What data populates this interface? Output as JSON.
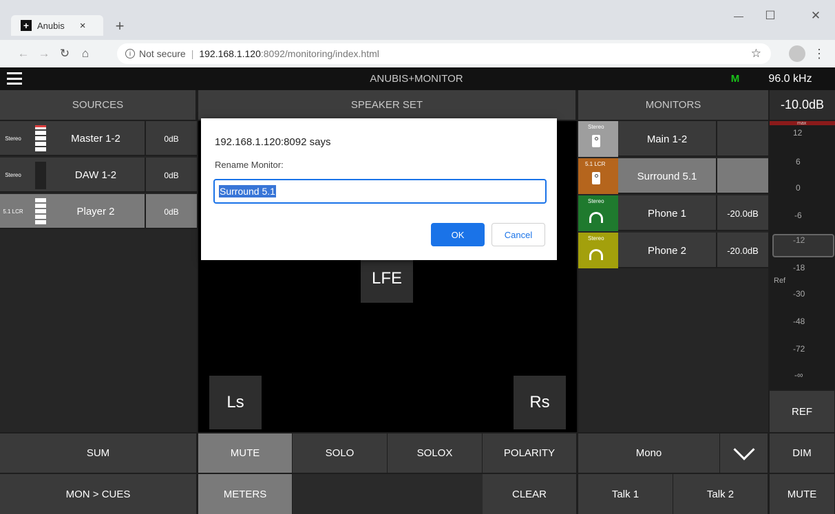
{
  "browser": {
    "tab_title": "Anubis",
    "tab_close": "×",
    "new_tab": "+",
    "security_label": "Not secure",
    "url_host": "192.168.1.120",
    "url_rest": ":8092/monitoring/index.html",
    "window_minimize": "—",
    "window_maximize": "☐",
    "window_close": "✕"
  },
  "app": {
    "title": "ANUBIS+MONITOR",
    "mode_indicator": "M",
    "sample_rate": "96.0 kHz"
  },
  "sources": {
    "header": "SOURCES",
    "items": [
      {
        "format": "Stereo",
        "name": "Master 1-2",
        "gain": "0dB"
      },
      {
        "format": "Stereo",
        "name": "DAW 1-2",
        "gain": "0dB"
      },
      {
        "format": "5.1 LCR",
        "name": "Player 2",
        "gain": "0dB"
      }
    ]
  },
  "speaker_set": {
    "header": "SPEAKER SET",
    "speakers": {
      "lfe": "LFE",
      "ls": "Ls",
      "rs": "Rs"
    }
  },
  "monitors": {
    "header": "MONITORS",
    "items": [
      {
        "format": "Stereo",
        "name": "Main 1-2",
        "gain": "",
        "icon": "speaker-icon",
        "color": "#9e9e9e"
      },
      {
        "format": "5.1 LCR",
        "name": "Surround 5.1",
        "gain": "",
        "icon": "speaker-icon",
        "color": "#b5651d"
      },
      {
        "format": "Stereo",
        "name": "Phone 1",
        "gain": "-20.0dB",
        "icon": "headphones-icon",
        "color": "#1f7a2e"
      },
      {
        "format": "Stereo",
        "name": "Phone 2",
        "gain": "-20.0dB",
        "icon": "headphones-icon",
        "color": "#a3a00c"
      }
    ]
  },
  "level": {
    "value": "-10.0dB",
    "max_label": "max",
    "ref_label": "Ref",
    "scale": [
      "12",
      "6",
      "0",
      "-6",
      "-12",
      "-18",
      "-30",
      "-48",
      "-72",
      "-∞"
    ]
  },
  "bottom": {
    "sum": "SUM",
    "mute": "MUTE",
    "solo": "SOLO",
    "solox": "SOLOX",
    "polarity": "POLARITY",
    "mono": "Mono",
    "dim": "DIM",
    "mon_cues": "MON > CUES",
    "meters": "METERS",
    "clear": "CLEAR",
    "talk1": "Talk 1",
    "talk2": "Talk 2",
    "master_mute": "MUTE",
    "ref": "REF"
  },
  "dialog": {
    "origin": "192.168.1.120:8092 says",
    "message": "Rename Monitor:",
    "input_value": "Surround 5.1",
    "ok": "OK",
    "cancel": "Cancel"
  },
  "colors": {
    "accent_blue": "#1a73e8",
    "mode_green": "#19c219"
  }
}
